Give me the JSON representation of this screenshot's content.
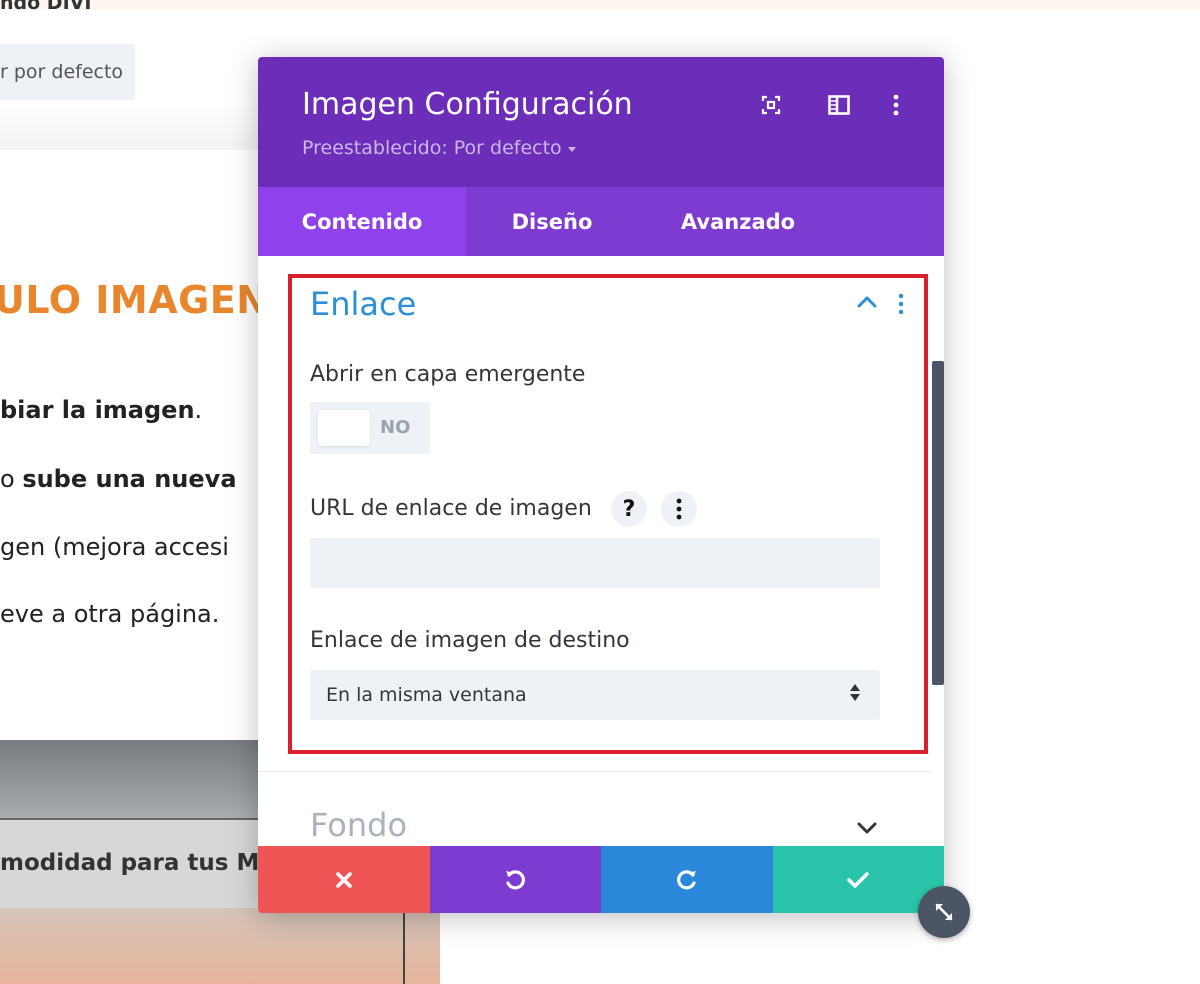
{
  "background": {
    "top_title": "ndo DIVI",
    "default_button": "r por defecto",
    "heading": "ULO IMAGEN",
    "lines": [
      {
        "pre": "",
        "bold": "biar la imagen",
        "post": "."
      },
      {
        "pre": " o ",
        "bold": "sube una nueva",
        "post": ""
      },
      {
        "pre": "gen (mejora accesi",
        "bold": "",
        "post": ""
      },
      {
        "pre": "eve a otra página.",
        "bold": "",
        "post": ""
      }
    ],
    "photo_caption": "modidad para tus M"
  },
  "modal": {
    "title": "Imagen Configuración",
    "preset": "Preestablecido: Por defecto",
    "tabs": [
      "Contenido",
      "Diseño",
      "Avanzado"
    ],
    "active_tab": "Contenido",
    "section": {
      "title": "Enlace",
      "popup_label": "Abrir en capa emergente",
      "popup_toggle": "NO",
      "url_label": "URL de enlace de imagen",
      "url_help": "?",
      "url_value": "",
      "target_label": "Enlace de imagen de destino",
      "target_value": "En la misma ventana"
    },
    "collapsed_section": "Fondo"
  },
  "colors": {
    "header": "#6c2eb9",
    "tabs": "#7d3bd2",
    "active_tab": "#8f42ec",
    "section_title": "#2d8fd5",
    "highlight": "#d9202c",
    "cancel": "#ef5555",
    "undo": "#7d3bd2",
    "redo": "#2b87da",
    "save": "#29c4a9"
  },
  "icons": {
    "fullscreen": "fullscreen-icon",
    "split": "split-view-icon",
    "menu": "vertical-dots-icon",
    "cancel": "close-icon",
    "undo": "undo-icon",
    "redo": "redo-icon",
    "save": "check-icon",
    "resize": "resize-icon"
  }
}
